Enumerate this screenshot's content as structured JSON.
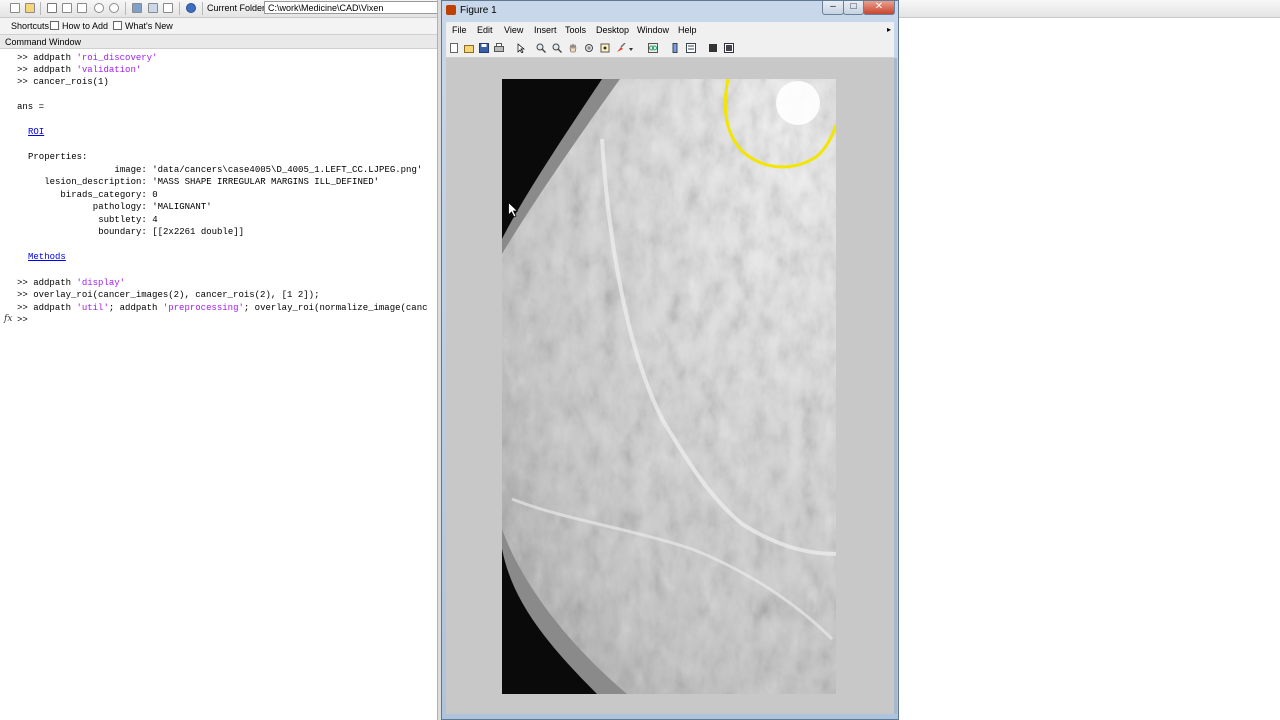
{
  "toolbar": {
    "current_folder_label": "Current Folder:",
    "current_folder_path": "C:\\work\\Medicine\\CAD\\Vixen"
  },
  "shortcuts": {
    "items": [
      "Shortcuts",
      "How to Add",
      "What's New"
    ]
  },
  "command_window": {
    "title": "Command Window",
    "prompt": ">>",
    "lines": {
      "l1": {
        "cmd": "addpath ",
        "arg": "'roi_discovery'"
      },
      "l2": {
        "cmd": "addpath ",
        "arg": "'validation'"
      },
      "l3": {
        "cmd": "cancer_rois(1)"
      },
      "ans": "ans =",
      "roi_link": "ROI",
      "properties": "Properties:",
      "p_image": "                image: 'data/cancers\\case4005\\D_4005_1.LEFT_CC.LJPEG.png'",
      "p_lesion": "   lesion_description: 'MASS SHAPE IRREGULAR MARGINS ILL_DEFINED'",
      "p_birads": "      birads_category: 0",
      "p_path": "            pathology: 'MALIGNANT'",
      "p_subtlety": "             subtlety: 4",
      "p_boundary": "             boundary: [[2x2261 double]]",
      "methods_link": "Methods",
      "l4": {
        "cmd": "addpath ",
        "arg": "'display'"
      },
      "l5": {
        "cmd": "overlay_roi(cancer_images(2), cancer_rois(2), [1 2]);"
      },
      "l6": {
        "cmd1": "addpath ",
        "arg1": "'util'",
        "cmd2": "; addpath ",
        "arg2": "'preprocessing'",
        "cmd3": "; overlay_roi(normalize_image(canc"
      }
    },
    "fx": "fx"
  },
  "figure": {
    "title": "Figure 1",
    "menu": [
      "File",
      "Edit",
      "View",
      "Insert",
      "Tools",
      "Desktop",
      "Window",
      "Help"
    ],
    "menu_arrow": "▸"
  },
  "colors": {
    "roi_boundary": "#f2e600",
    "string_literal": "#a020f0",
    "link": "#0000ee"
  }
}
